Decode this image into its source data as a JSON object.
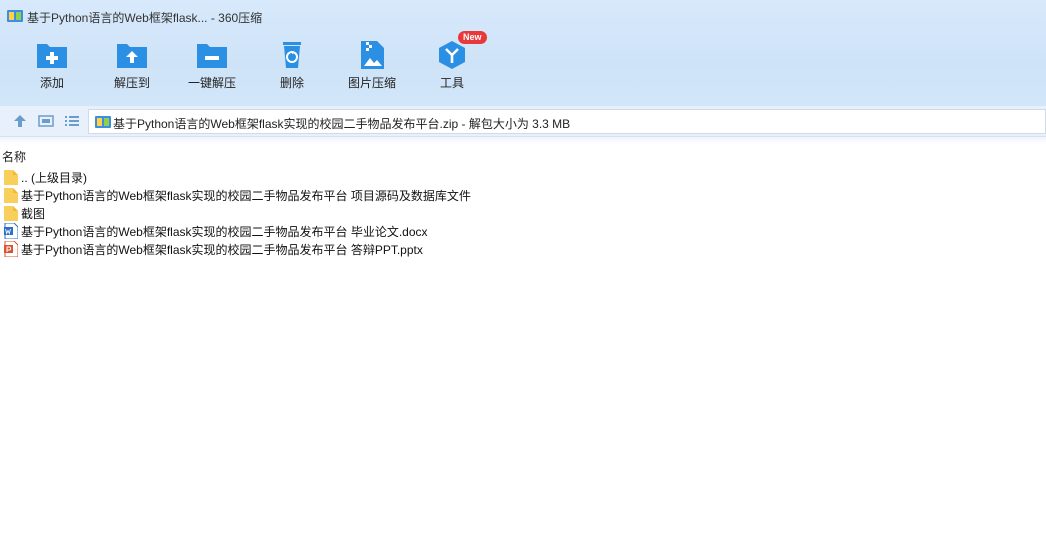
{
  "window": {
    "title": "基于Python语言的Web框架flask... - 360压缩"
  },
  "toolbar": {
    "items": [
      {
        "label": "添加",
        "icon": "add-folder-icon"
      },
      {
        "label": "解压到",
        "icon": "extract-to-icon"
      },
      {
        "label": "一键解压",
        "icon": "one-click-extract-icon"
      },
      {
        "label": "删除",
        "icon": "trash-icon"
      },
      {
        "label": "图片压缩",
        "icon": "image-compress-icon"
      },
      {
        "label": "工具",
        "icon": "tools-icon",
        "badge": "New"
      }
    ],
    "accent": "#2b8fe3"
  },
  "address": {
    "path": "基于Python语言的Web框架flask实现的校园二手物品发布平台.zip - 解包大小为 3.3 MB"
  },
  "list": {
    "column_name": "名称",
    "items": [
      {
        "name": ".. (上级目录)",
        "type": "folder"
      },
      {
        "name": "基于Python语言的Web框架flask实现的校园二手物品发布平台 项目源码及数据库文件",
        "type": "folder"
      },
      {
        "name": "截图",
        "type": "folder"
      },
      {
        "name": "基于Python语言的Web框架flask实现的校园二手物品发布平台 毕业论文.docx",
        "type": "docx"
      },
      {
        "name": "基于Python语言的Web框架flask实现的校园二手物品发布平台 答辩PPT.pptx",
        "type": "pptx"
      }
    ]
  }
}
